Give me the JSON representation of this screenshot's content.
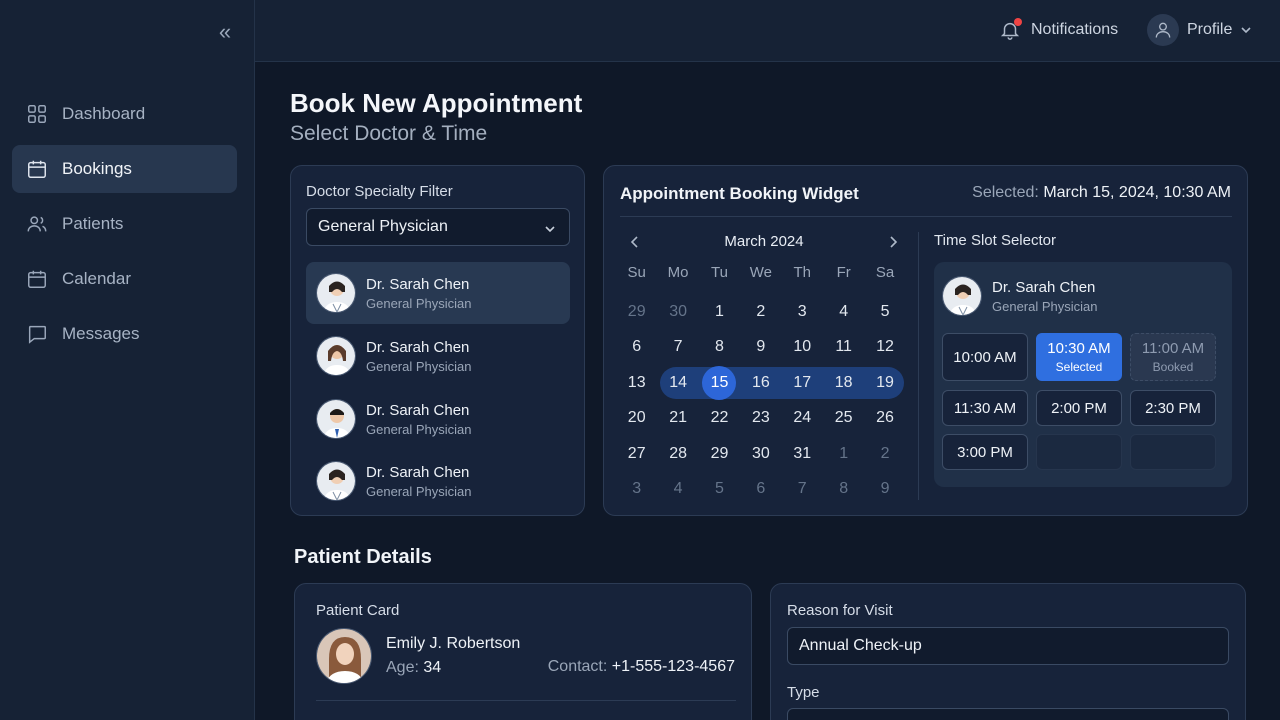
{
  "sidebar": {
    "items": [
      {
        "label": "Dashboard",
        "icon": "dashboard-icon"
      },
      {
        "label": "Bookings",
        "icon": "calendar-icon"
      },
      {
        "label": "Patients",
        "icon": "users-icon"
      },
      {
        "label": "Calendar",
        "icon": "calendar-icon"
      },
      {
        "label": "Messages",
        "icon": "message-icon"
      }
    ],
    "active": "Bookings"
  },
  "topbar": {
    "notifications_label": "Notifications",
    "profile_label": "Profile"
  },
  "page": {
    "title": "Book New Appointment",
    "subtitle": "Select Doctor & Time"
  },
  "filter": {
    "label": "Doctor Specialty Filter",
    "selected": "General Physician",
    "doctors": [
      {
        "name": "Dr. Sarah Chen",
        "specialty": "General Physician"
      },
      {
        "name": "Dr. Sarah Chen",
        "specialty": "General Physician"
      },
      {
        "name": "Dr. Sarah Chen",
        "specialty": "General Physician"
      },
      {
        "name": "Dr. Sarah Chen",
        "specialty": "General Physician"
      }
    ]
  },
  "widget": {
    "title": "Appointment Booking Widget",
    "selected_label": "Selected:",
    "selected_value": "March 15, 2024, 10:30 AM",
    "calendar": {
      "month": "March 2024",
      "weekdays": [
        "Su",
        "Mo",
        "Tu",
        "We",
        "Th",
        "Fr",
        "Sa"
      ],
      "weeks": [
        [
          "29",
          "30",
          "1",
          "2",
          "3",
          "4",
          "5"
        ],
        [
          "6",
          "7",
          "8",
          "9",
          "10",
          "11",
          "12"
        ],
        [
          "13",
          "14",
          "15",
          "16",
          "17",
          "18",
          "19"
        ],
        [
          "20",
          "21",
          "22",
          "23",
          "24",
          "25",
          "26"
        ],
        [
          "27",
          "28",
          "29",
          "30",
          "31",
          "1",
          "2"
        ],
        [
          "3",
          "4",
          "5",
          "6",
          "7",
          "8",
          "9"
        ]
      ]
    },
    "slots": {
      "title": "Time Slot Selector",
      "doctor_name": "Dr. Sarah Chen",
      "doctor_specialty": "General Physician",
      "times": [
        {
          "time": "10:00 AM",
          "state": "available",
          "sub": ""
        },
        {
          "time": "10:30 AM",
          "state": "selected",
          "sub": "Selected"
        },
        {
          "time": "11:00 AM",
          "state": "booked",
          "sub": "Booked"
        },
        {
          "time": "11:30 AM",
          "state": "available",
          "sub": ""
        },
        {
          "time": "2:00 PM",
          "state": "available",
          "sub": ""
        },
        {
          "time": "2:30 PM",
          "state": "available",
          "sub": ""
        },
        {
          "time": "3:00 PM",
          "state": "available",
          "sub": ""
        }
      ]
    }
  },
  "patient": {
    "section_title": "Patient Details",
    "card_label": "Patient Card",
    "name": "Emily J. Robertson",
    "age_label": "Age:",
    "age": "34",
    "contact_label": "Contact:",
    "contact": "+1-555-123-4567"
  },
  "reason": {
    "label": "Reason for Visit",
    "value": "Annual Check-up",
    "type_label": "Type"
  },
  "colors": {
    "accent": "#2f6fe0",
    "range": "#1e3f7a",
    "notification_dot": "#ef4444"
  }
}
